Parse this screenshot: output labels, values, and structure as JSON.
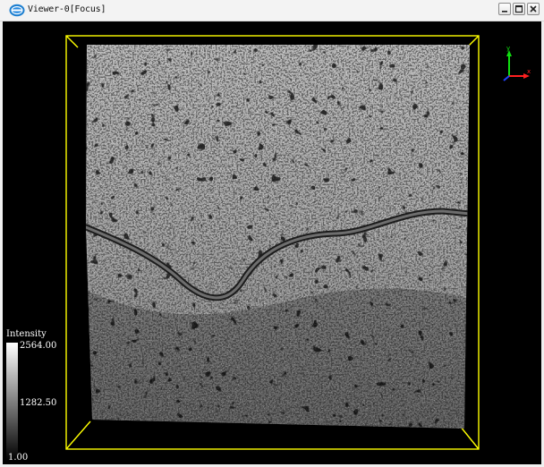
{
  "window": {
    "title": "Viewer-0[Focus]",
    "logo_icon": "app-logo-icon",
    "controls": [
      "minimize-icon",
      "maximize-icon",
      "close-icon"
    ]
  },
  "viewport": {
    "background": "#000000",
    "bounding_box_color": "#ffff00",
    "colormap": "grayscale intensity",
    "axes": {
      "x_label": "x",
      "y_label": "y",
      "x_color": "#ff2020",
      "y_color": "#10e010",
      "z_color": "#2040ff"
    }
  },
  "legend": {
    "title": "Intensity",
    "max": "2564.00",
    "mid": "1282.50",
    "min": "1.00"
  }
}
